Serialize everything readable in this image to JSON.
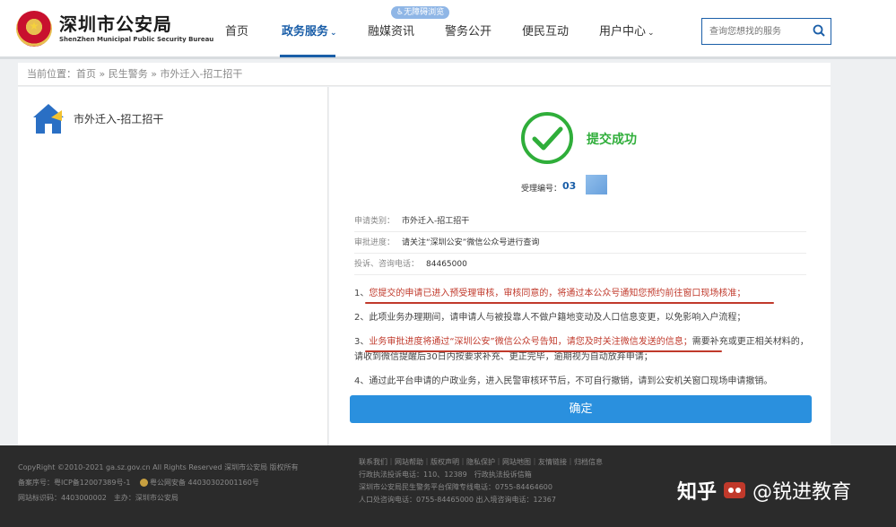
{
  "header": {
    "logo_cn": "深圳市公安局",
    "logo_en": "ShenZhen Municipal Public Security Bureau",
    "nav": [
      {
        "label": "首页",
        "active": false,
        "caret": ""
      },
      {
        "label": "政务服务",
        "active": true,
        "caret": "⌄"
      },
      {
        "label": "融媒资讯",
        "active": false,
        "caret": ""
      },
      {
        "label": "警务公开",
        "active": false,
        "caret": ""
      },
      {
        "label": "便民互动",
        "active": false,
        "caret": ""
      },
      {
        "label": "用户中心",
        "active": false,
        "caret": "⌄"
      }
    ],
    "accessibility_badge": "♿无障碍浏览",
    "search_placeholder": "查询您想找的服务"
  },
  "breadcrumb": "当前位置：首页 » 民生警务 » 市外迁入-招工招干",
  "left_panel": {
    "service_name": "市外迁入-招工招干"
  },
  "result": {
    "status": "提交成功",
    "accept_label": "受理编号：",
    "accept_no": "03",
    "info": [
      {
        "label": "申请类别：",
        "value": "市外迁入-招工招干"
      },
      {
        "label": "审批进度：",
        "value": "请关注“深圳公安”微信公众号进行查询"
      },
      {
        "label": "投诉、咨询电话：",
        "value": "84465000"
      }
    ],
    "notes": {
      "n1_prefix": "1、",
      "n1_red": "您提交的申请已进入预受理审核，审核同意的，将通过本公众号通知您预约前往窗口现场核准；",
      "n2": "2、此项业务办理期间，请申请人与被投靠人不做户籍地变动及人口信息变更，以免影响入户流程；",
      "n3_prefix": "3、",
      "n3_red": "业务审批进度将通过“深圳公安”微信公众号告知，请您及时关注微信发送的信息；",
      "n3_rest": "需要补充或更正相关材料的，请收到微信提醒后30日内按要求补充、更正完毕，逾期视为自动放弃申请；",
      "n4": "4、通过此平台申请的户政业务，进入民警审核环节后，不可自行撤销，请到公安机关窗口现场申请撤销。"
    },
    "confirm_label": "确定"
  },
  "footer": {
    "copyright": "CopyRight ©2010-2021 ga.sz.gov.cn All Rights Reserved 深圳市公安局 版权所有",
    "icp": "备案序号：粤ICP备12007389号-1",
    "police_record": "粤公网安备 44030302001160号",
    "site_code": "网站标识码：4403000002　主办：深圳市公安局",
    "links": "联系我们｜网站帮助｜版权声明｜隐私保护｜网站地图｜友情链接｜归档信息",
    "line2": "行政执法投诉电话：110、12389　行政执法投诉信箱",
    "line3": "深圳市公安局民生警务平台保障专线电话：0755-84464600",
    "line4": "人口处咨询电话：0755-84465000 出入境咨询电话：12367",
    "watermark_left": "知乎",
    "watermark_right": "@锐进教育"
  }
}
